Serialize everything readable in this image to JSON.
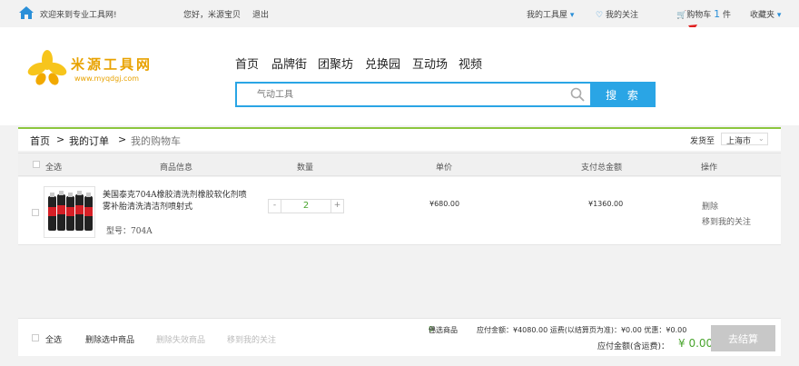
{
  "topbar": {
    "welcome": "欢迎来到专业工具网!",
    "greeting": "您好，米源宝贝",
    "logout": "退出",
    "my_tools": "我的工具屋",
    "my_follow": "我的关注",
    "cart_label": "购物车",
    "cart_count": "1",
    "cart_unit": "件",
    "favorites": "收藏夹"
  },
  "logo": {
    "name": "米源工具网",
    "url": "www.myqdgj.com"
  },
  "nav": [
    "首页",
    "品牌街",
    "团聚坊",
    "兑换园",
    "互动场",
    "视频"
  ],
  "search": {
    "placeholder": "气动工具",
    "button": "搜 索"
  },
  "breadcrumb": {
    "home": "首页",
    "sep": ">",
    "orders": "我的订单",
    "current": "我的购物车",
    "ship_label": "发货至",
    "ship_city": "上海市"
  },
  "table": {
    "headers": {
      "select_all": "全选",
      "info": "商品信息",
      "qty": "数量",
      "price": "单价",
      "total": "支付总金额",
      "ops": "操作"
    }
  },
  "item": {
    "title": "美国泰克704A橡胶清洗剂橡胶软化剂喷雾补胎清洗清洁剂喷射式",
    "model": "型号：704A",
    "qty": "2",
    "minus": "-",
    "plus": "+",
    "price": "¥680.00",
    "total": "¥1360.00",
    "delete": "删除",
    "move_follow": "移到我的关注"
  },
  "footer": {
    "select_all": "全选",
    "delete_selected": "删除选中商品",
    "delete_invalid": "删除失效商品",
    "move_follow": "移到我的关注",
    "selected_prefix": "已选商品",
    "selected_count": "0",
    "selected_suffix": "件",
    "summary": "应付金额：¥4080.00  运费(以结算页为准)：¥0.00  优惠：¥0.00",
    "pay_label": "应付金额(含运费)：",
    "pay_amount": "¥ 0.00",
    "checkout": "去结算"
  },
  "colors": {
    "accent": "#2aa5e5",
    "green": "#8cc63e",
    "red_arrow": "#e02020",
    "pay_green": "#4aa52e"
  }
}
